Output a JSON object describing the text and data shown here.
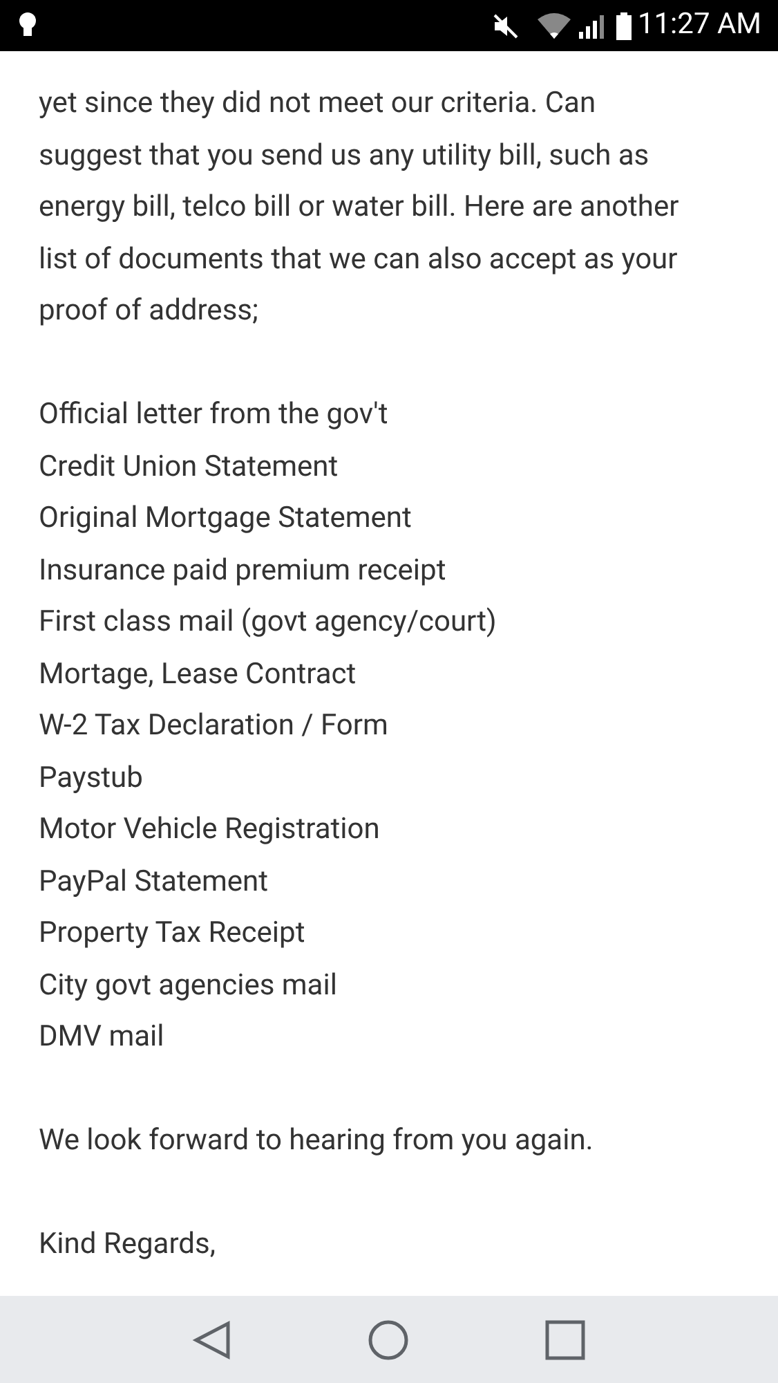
{
  "status_bar": {
    "time": "11:27 AM"
  },
  "email": {
    "paragraph": "yet since they did not meet our criteria. Can suggest that you send us any utility bill, such as energy bill, telco bill or water bill. Here are another list of documents that we can also accept as your proof of address;",
    "documents": [
      "Official letter from the gov't",
      "Credit Union Statement",
      "Original Mortgage Statement",
      "Insurance paid premium receipt",
      "First class mail (govt agency/court)",
      "Mortage, Lease Contract",
      "W-2 Tax Declaration / Form",
      "Paystub",
      "Motor Vehicle Registration",
      "PayPal Statement",
      "Property Tax Receipt",
      "City govt agencies mail",
      "DMV mail"
    ],
    "closing": "We look forward to hearing from you again.",
    "sign_off": "Kind Regards,"
  }
}
